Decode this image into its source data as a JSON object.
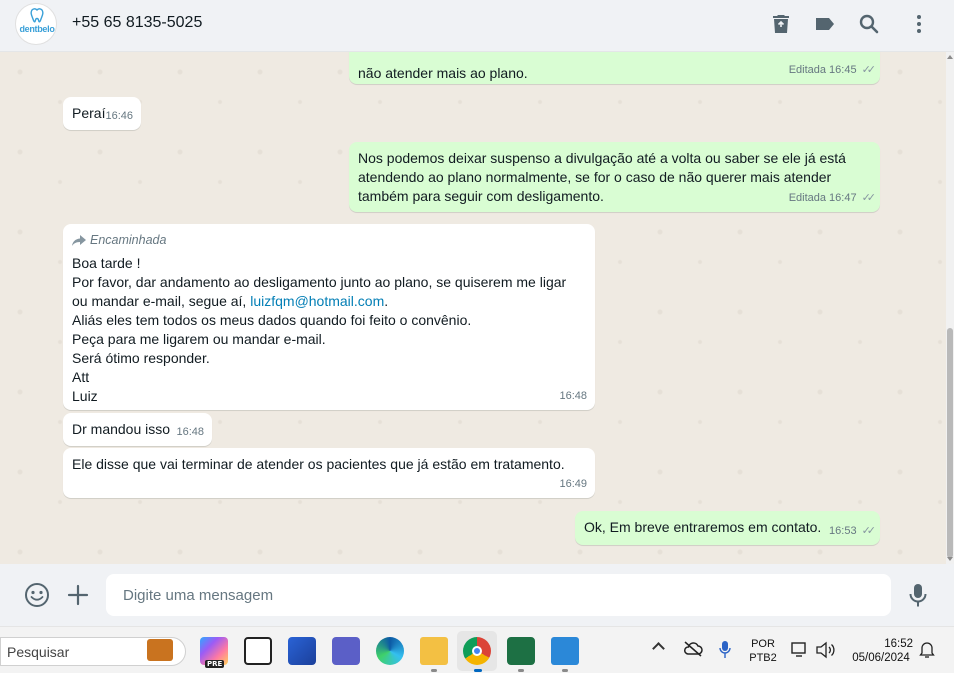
{
  "header": {
    "avatar_brand": "dentbelo",
    "contact": "+55 65 8135-5025",
    "icons": [
      "delete-icon",
      "label-icon",
      "search-icon",
      "menu-icon"
    ]
  },
  "messages": [
    {
      "dir": "out",
      "text": "não atender mais ao plano.",
      "status": "Editada",
      "time": "16:45"
    },
    {
      "dir": "in",
      "text": "Peraí",
      "time": "16:46"
    },
    {
      "dir": "out",
      "lines": [
        "Nos podemos deixar suspenso a divulgação até a volta ou saber se ele já está",
        "atendendo ao plano normalmente, se for o caso de não querer mais atender",
        "também para seguir com desligamento."
      ],
      "status": "Editada",
      "time": "16:47"
    },
    {
      "dir": "in",
      "forwarded": "Encaminhada",
      "lines": [
        "Boa tarde !",
        "Por favor, dar andamento ao desligamento junto ao plano, se quiserem me ligar",
        "ou mandar e-mail, segue aí, ",
        "Aliás eles tem todos os meus dados quando foi feito o convênio.",
        "Peça para me ligarem ou mandar e-mail.",
        "Será ótimo responder.",
        "Att",
        "Luiz"
      ],
      "link": "luizfqm@hotmail.com",
      "link_suffix": ".",
      "time": "16:48"
    },
    {
      "dir": "in",
      "text": "Dr mandou isso",
      "time": "16:48"
    },
    {
      "dir": "in",
      "text": "Ele disse que vai terminar de atender os pacientes que já estão em tratamento.",
      "time": "16:49"
    },
    {
      "dir": "out",
      "text": "Ok, Em breve entraremos em contato.",
      "time": "16:53"
    }
  ],
  "composer": {
    "placeholder": "Digite uma mensagem",
    "icons": [
      "emoji-icon",
      "attach-plus-icon",
      "microphone-icon"
    ]
  },
  "taskbar": {
    "search_placeholder": "Pesquisar",
    "language_1": "POR",
    "language_2": "PTB2",
    "time": "16:52",
    "date": "05/06/2024",
    "apps": [
      "briefcase-icon",
      "copilot-icon",
      "task-view-icon",
      "store-icon",
      "teams-icon",
      "edge-icon",
      "file-explorer-icon",
      "chrome-icon",
      "excel-icon",
      "notepad-icon"
    ]
  },
  "colors": {
    "outgoing_bubble": "#d9fdd3",
    "incoming_bubble": "#ffffff",
    "chat_background": "#efeae2",
    "link": "#027eb5"
  }
}
